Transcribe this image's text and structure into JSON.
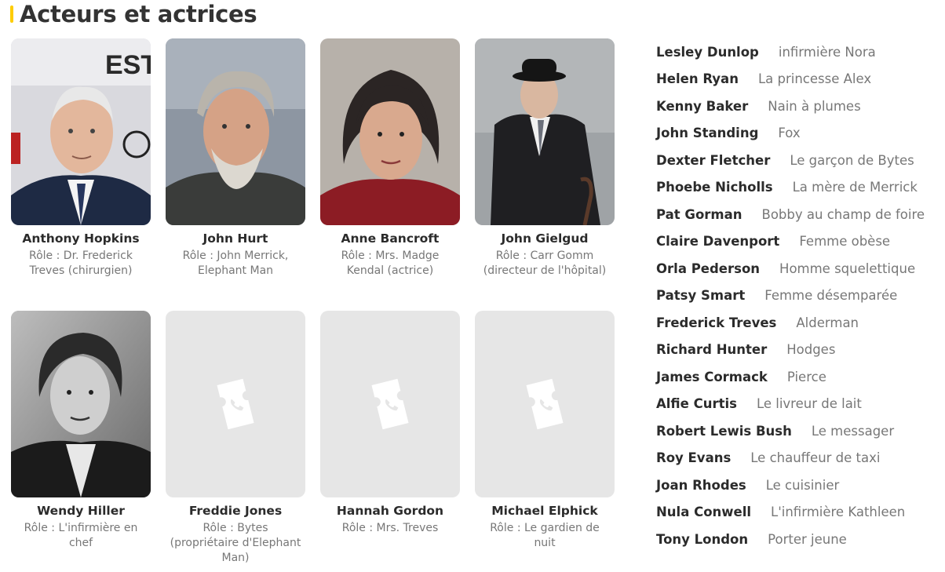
{
  "section": {
    "title": "Acteurs et actrices"
  },
  "cards": [
    {
      "name": "Anthony Hopkins",
      "role": "Rôle : Dr. Frederick Treves (chirurgien)"
    },
    {
      "name": "John Hurt",
      "role": "Rôle : John Merrick, Elephant Man"
    },
    {
      "name": "Anne Bancroft",
      "role": "Rôle : Mrs. Madge Kendal (actrice)"
    },
    {
      "name": "John Gielgud",
      "role": "Rôle : Carr Gomm (directeur de l'hôpital)"
    },
    {
      "name": "Wendy Hiller",
      "role": "Rôle : L'infirmière en chef"
    },
    {
      "name": "Freddie Jones",
      "role": "Rôle : Bytes (propriétaire d'Elephant Man)"
    },
    {
      "name": "Hannah Gordon",
      "role": "Rôle : Mrs. Treves"
    },
    {
      "name": "Michael Elphick",
      "role": "Rôle : Le gardien de nuit"
    }
  ],
  "cast": [
    {
      "name": "Lesley Dunlop",
      "role": "infirmière Nora"
    },
    {
      "name": "Helen Ryan",
      "role": "La princesse Alex"
    },
    {
      "name": "Kenny Baker",
      "role": "Nain à plumes"
    },
    {
      "name": "John Standing",
      "role": "Fox"
    },
    {
      "name": "Dexter Fletcher",
      "role": "Le garçon de Bytes"
    },
    {
      "name": "Phoebe Nicholls",
      "role": "La mère de Merrick"
    },
    {
      "name": "Pat Gorman",
      "role": "Bobby au champ de foire"
    },
    {
      "name": "Claire Davenport",
      "role": "Femme obèse"
    },
    {
      "name": "Orla Pederson",
      "role": "Homme squelettique"
    },
    {
      "name": "Patsy Smart",
      "role": "Femme désemparée"
    },
    {
      "name": "Frederick Treves",
      "role": "Alderman"
    },
    {
      "name": "Richard Hunter",
      "role": "Hodges"
    },
    {
      "name": "James Cormack",
      "role": "Pierce"
    },
    {
      "name": "Alfie Curtis",
      "role": "Le livreur de lait"
    },
    {
      "name": "Robert Lewis Bush",
      "role": "Le messager"
    },
    {
      "name": "Roy Evans",
      "role": "Le chauffeur de taxi"
    },
    {
      "name": "Joan Rhodes",
      "role": "Le cuisinier"
    },
    {
      "name": "Nula Conwell",
      "role": "L'infirmière Kathleen"
    },
    {
      "name": "Tony London",
      "role": "Porter jeune"
    }
  ],
  "colors": {
    "accent": "#fecc00",
    "placeholder": "#e6e6e6",
    "muted": "#777777"
  }
}
